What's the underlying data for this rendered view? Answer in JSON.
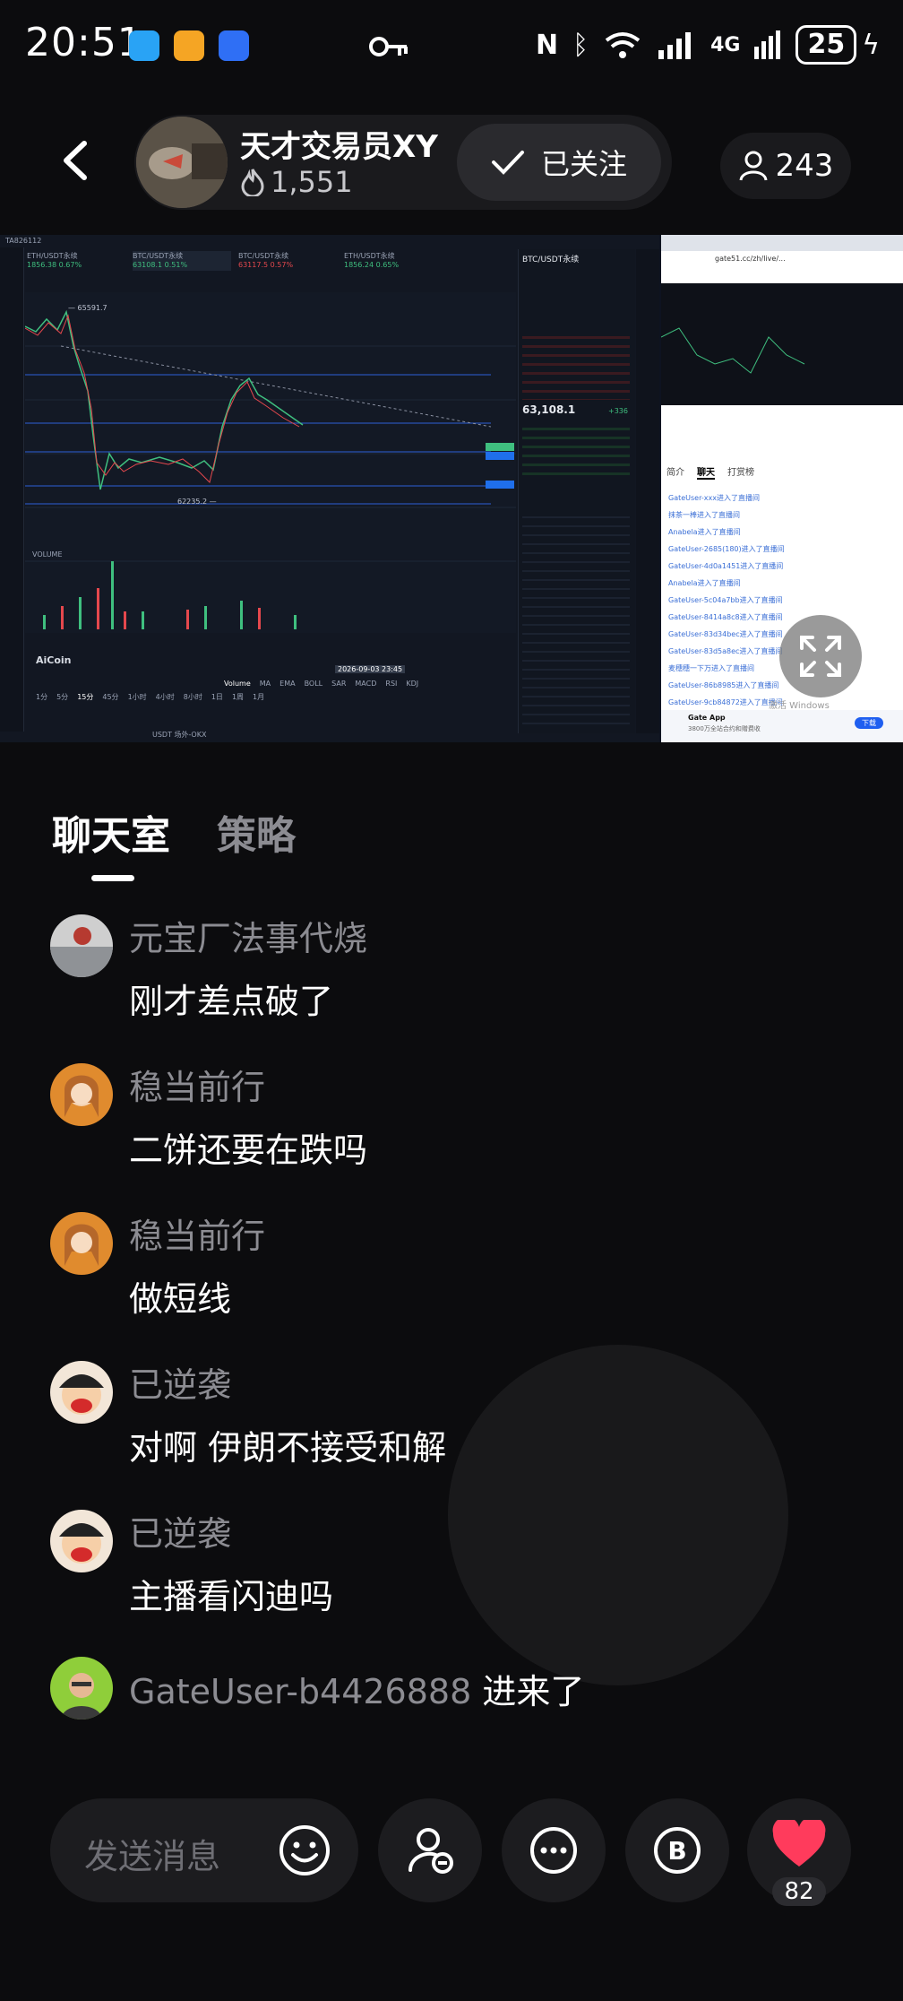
{
  "status_bar": {
    "time": "20:51",
    "battery": "25",
    "network": "4G",
    "wifi_label": "6"
  },
  "header": {
    "host_name": "天才交易员XY",
    "host_likes": "1,551",
    "follow_label": "已关注",
    "viewer_count": "243"
  },
  "stream": {
    "trading_window_title": "TA826112",
    "pair_title": "BTC/USDT永续",
    "price": "63,108.1",
    "change": "+336",
    "tickers": [
      {
        "name": "ETH/USDT永续",
        "price": "1856.38",
        "change": "0.67%"
      },
      {
        "name": "BTC/USDT永续",
        "price": "63108.1",
        "change": "0.51%"
      },
      {
        "name": "BTC/USDT永续",
        "price": "63117.5",
        "change": "0.57%"
      },
      {
        "name": "ETH/USDT永续",
        "price": "1856.24",
        "change": "0.65%"
      }
    ],
    "chart_high": "65591.7",
    "chart_low": "62235.2",
    "volume_label": "VOLUME",
    "chart_brand": "AiCoin",
    "chart_date": "2026-09-03 23:45",
    "timeframes": [
      "1分",
      "5分",
      "15分",
      "45分",
      "1小时",
      "4小时",
      "8小时",
      "1日",
      "1周",
      "1月"
    ],
    "indicators": [
      "Volume",
      "MA",
      "EMA",
      "BOLL",
      "SAR",
      "MACD",
      "RSI",
      "KDJ"
    ],
    "bottom_status": "USDT 场外-OKX",
    "browser_url": "gate51.cc/zh/live/...",
    "browser_tabs": [
      "简介",
      "聊天",
      "打赏榜"
    ],
    "browser_chat": [
      "GateUser-xxx进入了直播间",
      "抹茶一棒进入了直播间",
      "Anabela进入了直播间",
      "GateUser-2685(180)进入了直播间",
      "GateUser-4d0a1451进入了直播间",
      "Anabela进入了直播间",
      "GateUser-5c04a7bb进入了直播间",
      "GateUser-8414a8c8进入了直播间",
      "GateUser-83d34bec进入了直播间",
      "GateUser-83d5a8ec进入了直播间",
      "麦穗穗一下万进入了直播间",
      "GateUser-86b8985进入了直播间",
      "GateUser-9cb84872进入了直播间"
    ],
    "gate_app_title": "Gate App",
    "gate_app_sub": "3800万全站合约和赠费收",
    "gate_download": "下载",
    "windows_watermark": "激活 Windows"
  },
  "tabs": [
    {
      "label": "聊天室",
      "active": true
    },
    {
      "label": "策略",
      "active": false
    }
  ],
  "messages": [
    {
      "user": "元宝厂法事代烧",
      "text": "刚才差点破了"
    },
    {
      "user": "稳当前行",
      "text": "二饼还要在跌吗"
    },
    {
      "user": "稳当前行",
      "text": "做短线"
    },
    {
      "user": "已逆袭",
      "text": "对啊 伊朗不接受和解"
    },
    {
      "user": "已逆袭",
      "text": "主播看闪迪吗"
    }
  ],
  "join_event": {
    "user": "GateUser-b4426888",
    "text": "进来了"
  },
  "bottom_bar": {
    "input_placeholder": "发送消息",
    "like_count": "82"
  },
  "colors": {
    "background": "#0c0c0e",
    "like_red": "#ff3b5c",
    "chart_up": "#3fbf7f",
    "chart_down": "#e5484d"
  }
}
